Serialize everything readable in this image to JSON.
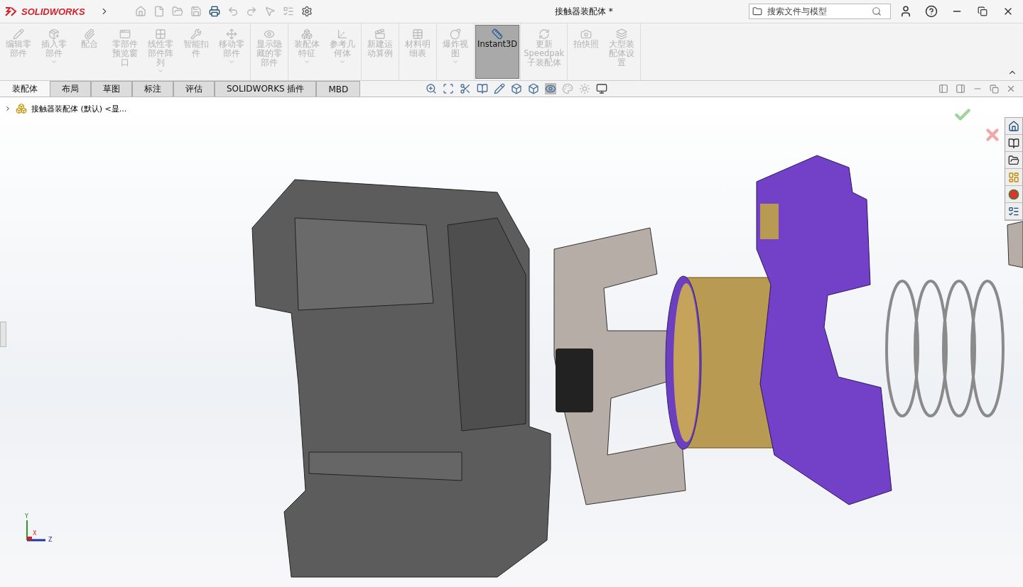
{
  "app": {
    "logo": "SOLIDWORKS"
  },
  "document_title": "接触器装配体 *",
  "search": {
    "placeholder": "搜索文件与模型"
  },
  "ribbon": {
    "groups": [
      [
        {
          "label": "编辑零部件",
          "disabled": true,
          "dropdown": false,
          "selected": false
        },
        {
          "label": "插入零部件",
          "disabled": true,
          "dropdown": true,
          "selected": false
        },
        {
          "label": "配合",
          "disabled": true,
          "dropdown": false,
          "selected": false
        },
        {
          "label": "零部件预览窗口",
          "disabled": true,
          "dropdown": false,
          "selected": false
        },
        {
          "label": "线性零部件阵列",
          "disabled": true,
          "dropdown": true,
          "selected": false
        },
        {
          "label": "智能扣件",
          "disabled": true,
          "dropdown": false,
          "selected": false
        },
        {
          "label": "移动零部件",
          "disabled": true,
          "dropdown": true,
          "selected": false
        }
      ],
      [
        {
          "label": "显示隐藏的零部件",
          "disabled": true,
          "dropdown": false,
          "selected": false
        }
      ],
      [
        {
          "label": "装配体特征",
          "disabled": true,
          "dropdown": true,
          "selected": false
        },
        {
          "label": "参考几何体",
          "disabled": true,
          "dropdown": true,
          "selected": false
        }
      ],
      [
        {
          "label": "新建运动算例",
          "disabled": true,
          "dropdown": false,
          "selected": false
        }
      ],
      [
        {
          "label": "材料明细表",
          "disabled": true,
          "dropdown": false,
          "selected": false
        }
      ],
      [
        {
          "label": "爆炸视图",
          "disabled": true,
          "dropdown": true,
          "selected": false
        }
      ],
      [
        {
          "label": "Instant3D",
          "disabled": false,
          "dropdown": false,
          "selected": true
        }
      ],
      [
        {
          "label": "更新Speedpak子装配体",
          "disabled": true,
          "dropdown": false,
          "selected": false
        }
      ],
      [
        {
          "label": "拍快照",
          "disabled": true,
          "dropdown": false,
          "selected": false
        },
        {
          "label": "大型装配体设置",
          "disabled": true,
          "dropdown": false,
          "selected": false
        }
      ]
    ]
  },
  "tabs": [
    {
      "label": "装配体",
      "selected": true
    },
    {
      "label": "布局",
      "selected": false
    },
    {
      "label": "草图",
      "selected": false
    },
    {
      "label": "标注",
      "selected": false
    },
    {
      "label": "评估",
      "selected": false
    },
    {
      "label": "SOLIDWORKS 插件",
      "selected": false
    },
    {
      "label": "MBD",
      "selected": false
    }
  ],
  "tree": {
    "root": {
      "label": "接触器装配体 (默认) <显...",
      "expanded": false
    }
  },
  "triad": {
    "axes": [
      "Y",
      "X",
      "Z"
    ]
  }
}
